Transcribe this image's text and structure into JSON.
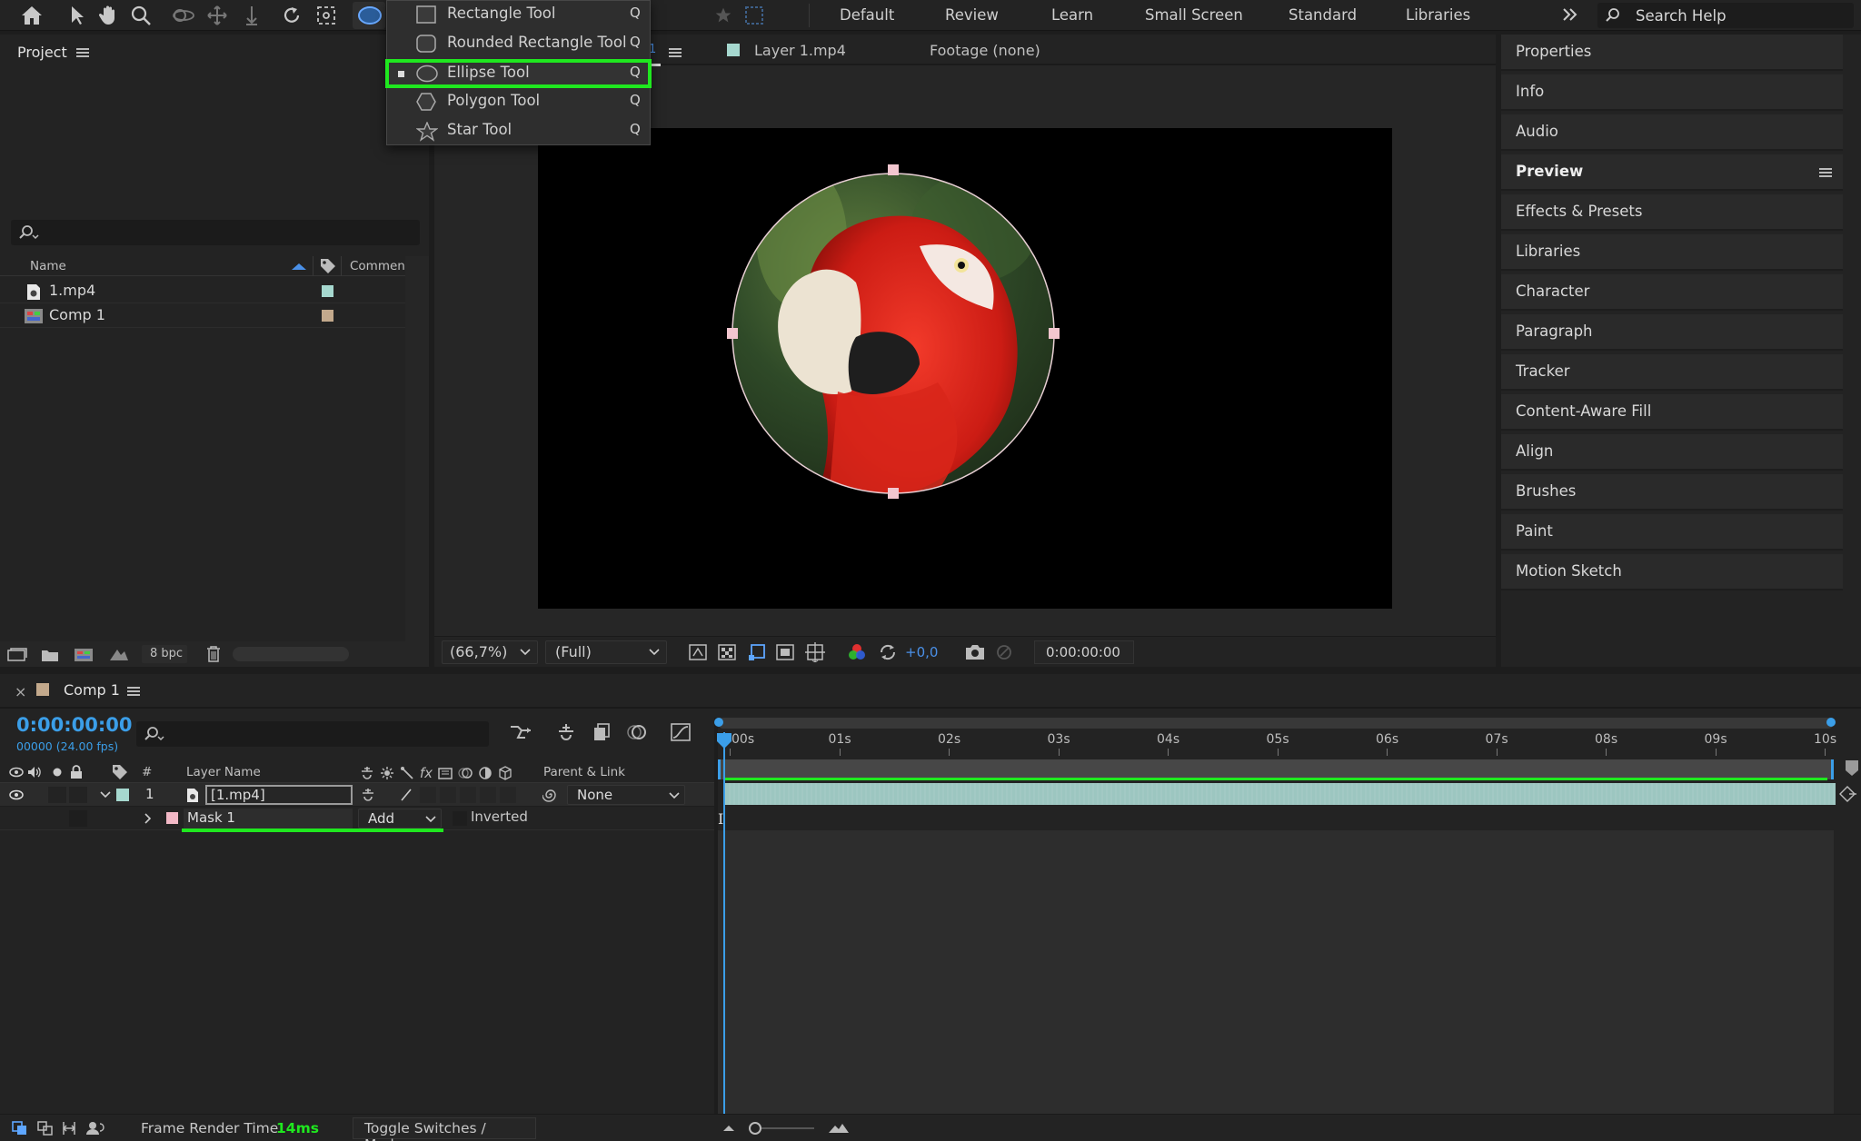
{
  "workspaces": [
    "Default",
    "Review",
    "Learn",
    "Small Screen",
    "Standard",
    "Libraries"
  ],
  "search_help": {
    "label": "Search Help"
  },
  "tool_menu": {
    "items": [
      {
        "label": "Rectangle Tool",
        "key": "Q",
        "icon": "rectangle-icon"
      },
      {
        "label": "Rounded Rectangle Tool",
        "key": "Q",
        "icon": "rounded-rectangle-icon"
      },
      {
        "label": "Ellipse Tool",
        "key": "Q",
        "icon": "ellipse-icon"
      },
      {
        "label": "Polygon Tool",
        "key": "Q",
        "icon": "polygon-icon"
      },
      {
        "label": "Star Tool",
        "key": "Q",
        "icon": "star-icon"
      }
    ],
    "selected": "Ellipse Tool"
  },
  "project": {
    "title": "Project",
    "columns": {
      "name": "Name",
      "comment": "Comment"
    },
    "items": [
      {
        "name": "1.mp4",
        "color": "#a6d8cf"
      },
      {
        "name": "Comp 1",
        "color": "#c3a98c"
      }
    ],
    "bpc": "8 bpc"
  },
  "viewer": {
    "tab_marker": "1",
    "layer_tab": "Layer 1.mp4",
    "footage_tab": "Footage (none)",
    "zoom": "(66,7%)",
    "resolution": "(Full)",
    "exposure": "+0,0",
    "timecode": "0:00:00:00"
  },
  "right_panel": {
    "items": [
      "Properties",
      "Info",
      "Audio",
      "Preview",
      "Effects & Presets",
      "Libraries",
      "Character",
      "Paragraph",
      "Tracker",
      "Content-Aware Fill",
      "Align",
      "Brushes",
      "Paint",
      "Motion Sketch"
    ]
  },
  "timeline": {
    "comp_tab": "Comp 1",
    "comp_color": "#c3a98c",
    "timecode": "0:00:00:00",
    "frame_info": "00000 (24.00 fps)",
    "columns": {
      "num": "#",
      "layer_name": "Layer Name",
      "parent": "Parent & Link"
    },
    "layer": {
      "num": "1",
      "name": "[1.mp4]",
      "color": "#a6d8cf",
      "parent": "None"
    },
    "mask": {
      "name": "Mask 1",
      "mode": "Add",
      "inverted": "Inverted",
      "color": "#f2b8c6"
    },
    "ticks": [
      "00s",
      "01s",
      "02s",
      "03s",
      "04s",
      "05s",
      "06s",
      "07s",
      "08s",
      "09s",
      "10s"
    ],
    "frame_render_label": "Frame Render Time",
    "frame_render_value": "14ms",
    "toggle_label": "Toggle Switches / Modes"
  },
  "colors": {
    "accent": "#1fe81f",
    "timecode": "#3b9ee8",
    "layer_bar": "#9cc6c0"
  }
}
